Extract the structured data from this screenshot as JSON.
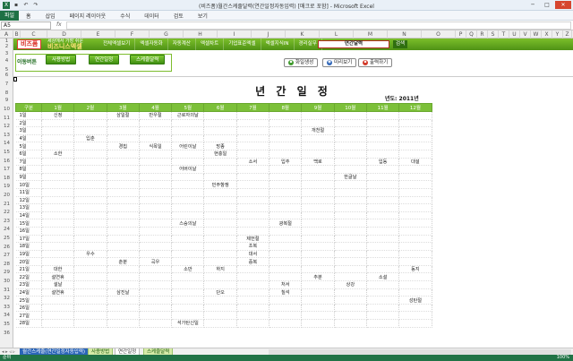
{
  "window": {
    "title": "(비즈폼)월간스케줄달력(연간일정자동입력) [매크로 포함] - Microsoft Excel",
    "minimize": "─",
    "maximize": "□",
    "close": "✕"
  },
  "ribbon_tabs": [
    "파일",
    "홈",
    "삽입",
    "페이지 레이아웃",
    "수식",
    "데이터",
    "검토",
    "보기"
  ],
  "formula_bar": {
    "name_box": "A5",
    "fx": "fx",
    "value": ""
  },
  "columns": [
    "A",
    "B",
    "C",
    "D",
    "E",
    "F",
    "G",
    "H",
    "I",
    "J",
    "K",
    "L",
    "M",
    "N",
    "O",
    "P",
    "Q",
    "R",
    "S",
    "T",
    "U",
    "V",
    "W",
    "X",
    "Y",
    "Z",
    "AA",
    "AB",
    "AC",
    "AD",
    "AE"
  ],
  "rows": [
    "1",
    "2",
    "3",
    "4",
    "5",
    "6",
    "7",
    "8",
    "9",
    "10",
    "11",
    "12",
    "13",
    "14",
    "15",
    "16",
    "17",
    "18",
    "19",
    "20",
    "21",
    "22",
    "23",
    "24",
    "25",
    "26",
    "27",
    "28",
    "29",
    "30",
    "31",
    "32",
    "33",
    "34",
    "35",
    "36"
  ],
  "menu": {
    "logo": "비즈폼",
    "logo_sub": "세상에서 가장 쉬운",
    "logo_main": "비즈니스엑셀",
    "nav": [
      "전체엑셀보기",
      "엑셀자동화",
      "자동계산",
      "엑셀차트",
      "기업표준엑셀",
      "엑셀지식IN",
      "경리실무"
    ],
    "search_value": "연간달력",
    "search_button": "검색"
  },
  "subbar": {
    "version_label": "이동버튼",
    "buttons": [
      "사용방법",
      "연간일정",
      "스케줄달력"
    ],
    "actions": [
      {
        "label": "화일생성",
        "icon": "file-icon",
        "color": "#3f9a2d"
      },
      {
        "label": "미리보기",
        "icon": "preview-icon",
        "color": "#2f66b8"
      },
      {
        "label": "출력하기",
        "icon": "print-icon",
        "color": "#d23a2a"
      }
    ]
  },
  "calendar": {
    "title": "년 간 일 정",
    "year_label": "년도:  2011년",
    "header_corner": "구분",
    "months": [
      "1월",
      "2월",
      "3월",
      "4월",
      "5월",
      "6월",
      "7월",
      "8월",
      "9월",
      "10월",
      "11월",
      "12월"
    ],
    "rows": [
      [
        "1일",
        "신정",
        "",
        "삼일절",
        "만우절",
        "근로자의날",
        "",
        "",
        "",
        "",
        "",
        "",
        ""
      ],
      [
        "2일",
        "",
        "",
        "",
        "",
        "",
        "",
        "",
        "",
        "",
        "",
        "",
        ""
      ],
      [
        "3일",
        "",
        "",
        "",
        "",
        "",
        "",
        "",
        "",
        "개천절",
        "",
        "",
        ""
      ],
      [
        "4일",
        "",
        "입춘",
        "",
        "",
        "",
        "",
        "",
        "",
        "",
        "",
        "",
        ""
      ],
      [
        "5일",
        "",
        "",
        "경칩",
        "식목일",
        "어린이날",
        "망종",
        "",
        "",
        "",
        "",
        "",
        ""
      ],
      [
        "6일",
        "소한",
        "",
        "",
        "",
        "",
        "현충일",
        "",
        "",
        "",
        "",
        "",
        ""
      ],
      [
        "7일",
        "",
        "",
        "",
        "",
        "",
        "",
        "소서",
        "입추",
        "백로",
        "",
        "입동",
        "대설"
      ],
      [
        "8일",
        "",
        "",
        "",
        "",
        "어버이날",
        "",
        "",
        "",
        "",
        "",
        "",
        ""
      ],
      [
        "9일",
        "",
        "",
        "",
        "",
        "",
        "",
        "",
        "",
        "",
        "한글날",
        "",
        ""
      ],
      [
        "10일",
        "",
        "",
        "",
        "",
        "",
        "민주항쟁",
        "",
        "",
        "",
        "",
        "",
        ""
      ],
      [
        "11일",
        "",
        "",
        "",
        "",
        "",
        "",
        "",
        "",
        "",
        "",
        "",
        ""
      ],
      [
        "12일",
        "",
        "",
        "",
        "",
        "",
        "",
        "",
        "",
        "",
        "",
        "",
        ""
      ],
      [
        "13일",
        "",
        "",
        "",
        "",
        "",
        "",
        "",
        "",
        "",
        "",
        "",
        ""
      ],
      [
        "14일",
        "",
        "",
        "",
        "",
        "",
        "",
        "",
        "",
        "",
        "",
        "",
        ""
      ],
      [
        "15일",
        "",
        "",
        "",
        "",
        "스승의날",
        "",
        "",
        "광복절",
        "",
        "",
        "",
        ""
      ],
      [
        "16일",
        "",
        "",
        "",
        "",
        "",
        "",
        "",
        "",
        "",
        "",
        "",
        ""
      ],
      [
        "17일",
        "",
        "",
        "",
        "",
        "",
        "",
        "제헌절",
        "",
        "",
        "",
        "",
        ""
      ],
      [
        "18일",
        "",
        "",
        "",
        "",
        "",
        "",
        "초복",
        "",
        "",
        "",
        "",
        ""
      ],
      [
        "19일",
        "",
        "우수",
        "",
        "",
        "",
        "",
        "대서",
        "",
        "",
        "",
        "",
        ""
      ],
      [
        "20일",
        "",
        "",
        "춘분",
        "곡우",
        "",
        "",
        "중복",
        "",
        "",
        "",
        "",
        ""
      ],
      [
        "21일",
        "대한",
        "",
        "",
        "",
        "소만",
        "하지",
        "",
        "",
        "",
        "",
        "",
        "동지"
      ],
      [
        "22일",
        "설연휴",
        "",
        "",
        "",
        "",
        "",
        "",
        "",
        "추분",
        "",
        "소설",
        ""
      ],
      [
        "23일",
        "설날",
        "",
        "",
        "",
        "",
        "",
        "",
        "처서",
        "",
        "상강",
        "",
        ""
      ],
      [
        "24일",
        "설연휴",
        "",
        "삼진날",
        "",
        "",
        "단오",
        "",
        "칠석",
        "",
        "",
        "",
        ""
      ],
      [
        "25일",
        "",
        "",
        "",
        "",
        "",
        "",
        "",
        "",
        "",
        "",
        "",
        "성탄절"
      ],
      [
        "26일",
        "",
        "",
        "",
        "",
        "",
        "",
        "",
        "",
        "",
        "",
        "",
        ""
      ],
      [
        "27일",
        "",
        "",
        "",
        "",
        "",
        "",
        "",
        "",
        "",
        "",
        "",
        ""
      ],
      [
        "28일",
        "",
        "",
        "",
        "",
        "석가탄신일",
        "",
        "",
        "",
        "",
        "",
        "",
        ""
      ]
    ]
  },
  "sheet_tabs": {
    "nav": "◂ ▸ ◃ ▹",
    "tabs": [
      "월간스케줄(연간일정자동입력)",
      "사용방법",
      "연간일정",
      "스케줄달력"
    ]
  },
  "status": {
    "ready": "준비",
    "zoom": "100%"
  }
}
